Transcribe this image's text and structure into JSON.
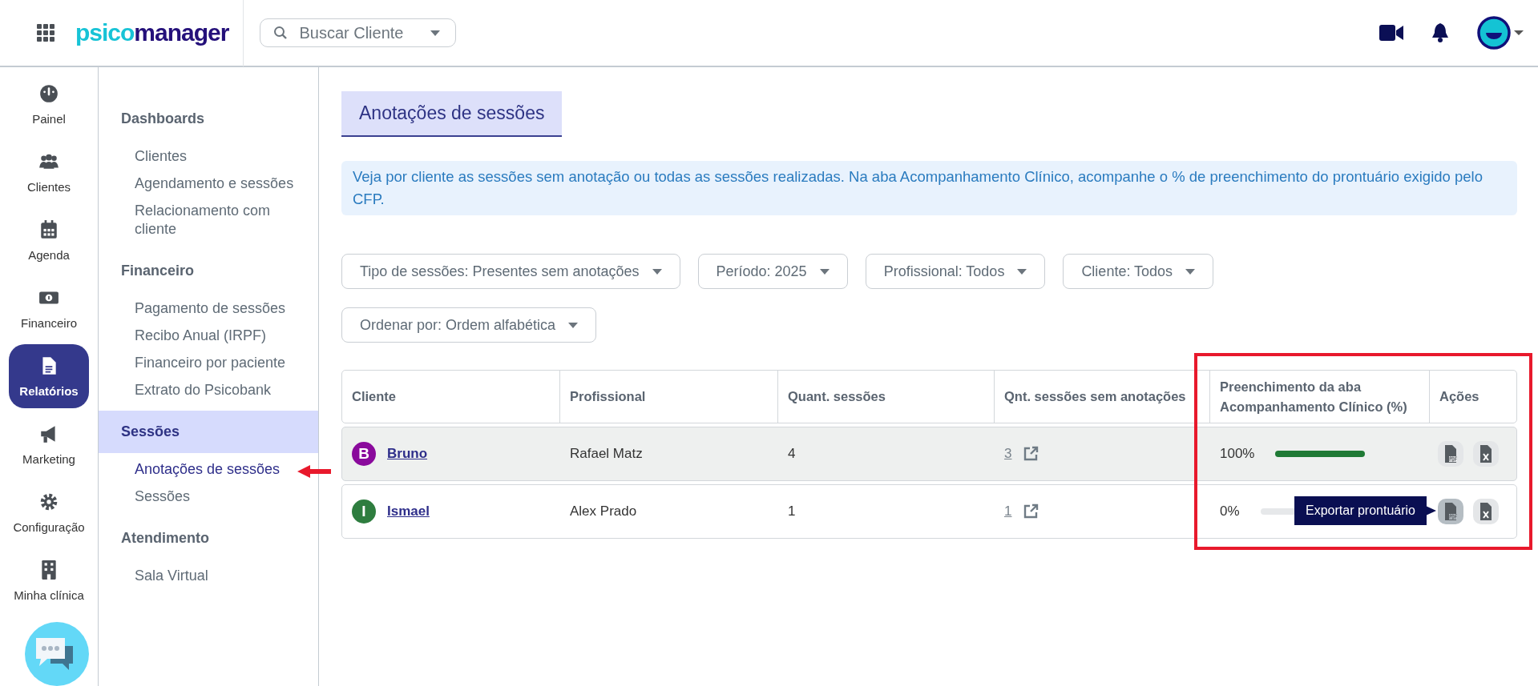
{
  "top_bar": {
    "logo": [
      "psico",
      "manager"
    ],
    "search": {
      "placeholder": "Buscar Cliente"
    }
  },
  "nav_rail": [
    {
      "label": "Painel",
      "selected": false
    },
    {
      "label": "Clientes",
      "selected": false
    },
    {
      "label": "Agenda",
      "selected": false
    },
    {
      "label": "Financeiro",
      "selected": false
    },
    {
      "label": "Relatórios",
      "selected": true
    },
    {
      "label": "Marketing",
      "selected": false
    },
    {
      "label": "Configuração",
      "selected": false
    },
    {
      "label": "Minha clínica",
      "selected": false
    }
  ],
  "submenu": [
    {
      "title": "Dashboards",
      "selected": false,
      "items": [
        {
          "label": "Clientes",
          "selected": false
        },
        {
          "label": "Agendamento e sessões",
          "selected": false
        },
        {
          "label": "Relacionamento com cliente",
          "selected": false
        }
      ]
    },
    {
      "title": "Financeiro",
      "selected": false,
      "items": [
        {
          "label": "Pagamento de sessões",
          "selected": false
        },
        {
          "label": "Recibo Anual (IRPF)",
          "selected": false
        },
        {
          "label": "Financeiro por paciente",
          "selected": false
        },
        {
          "label": "Extrato do Psicobank",
          "selected": false
        }
      ]
    },
    {
      "title": "Sessões",
      "selected": true,
      "items": [
        {
          "label": "Anotações de sessões",
          "selected": true
        },
        {
          "label": "Sessões",
          "selected": false
        }
      ]
    },
    {
      "title": "Atendimento",
      "selected": false,
      "items": [
        {
          "label": "Sala Virtual",
          "selected": false
        }
      ]
    }
  ],
  "page_title": "Anotações de sessões",
  "info": "Veja por cliente as sessões sem anotação ou todas as sessões realizadas. Na aba Acompanhamento Clínico, acompanhe o % de preenchimento do prontuário exigido pelo CFP.",
  "filters": [
    [
      "Tipo de sessões: Presentes sem anotações",
      "Período: 2025",
      "Profissional: Todos",
      "Cliente: Todos"
    ],
    [
      "Ordenar por: Ordem alfabética"
    ]
  ],
  "table": {
    "columns": [
      "Cliente",
      "Profissional",
      "Quant. sessões",
      "Qnt. sessões sem anotações",
      "Preenchimento da aba Acompanhamento Clínico (%)",
      "Ações"
    ],
    "rows": [
      {
        "selected": true,
        "initial": "B",
        "color": "#8a0a9c",
        "client": "Bruno",
        "professional": "Rafael Matz",
        "sessions": "4",
        "unannotated": "3",
        "fill_reading": "100%",
        "level": 1,
        "actions": [
          {
            "kind": "pdf",
            "active": false
          },
          {
            "kind": "excel",
            "active": false
          }
        ]
      },
      {
        "selected": false,
        "initial": "I",
        "color": "#2e7d3f",
        "client": "Ismael",
        "professional": "Alex Prado",
        "sessions": "1",
        "unannotated": "1",
        "fill_reading": "0%",
        "level": 0,
        "actions": [
          {
            "kind": "pdf",
            "active": true,
            "tooltip": "Exportar prontuário"
          },
          {
            "kind": "excel",
            "active": false
          }
        ]
      }
    ]
  }
}
